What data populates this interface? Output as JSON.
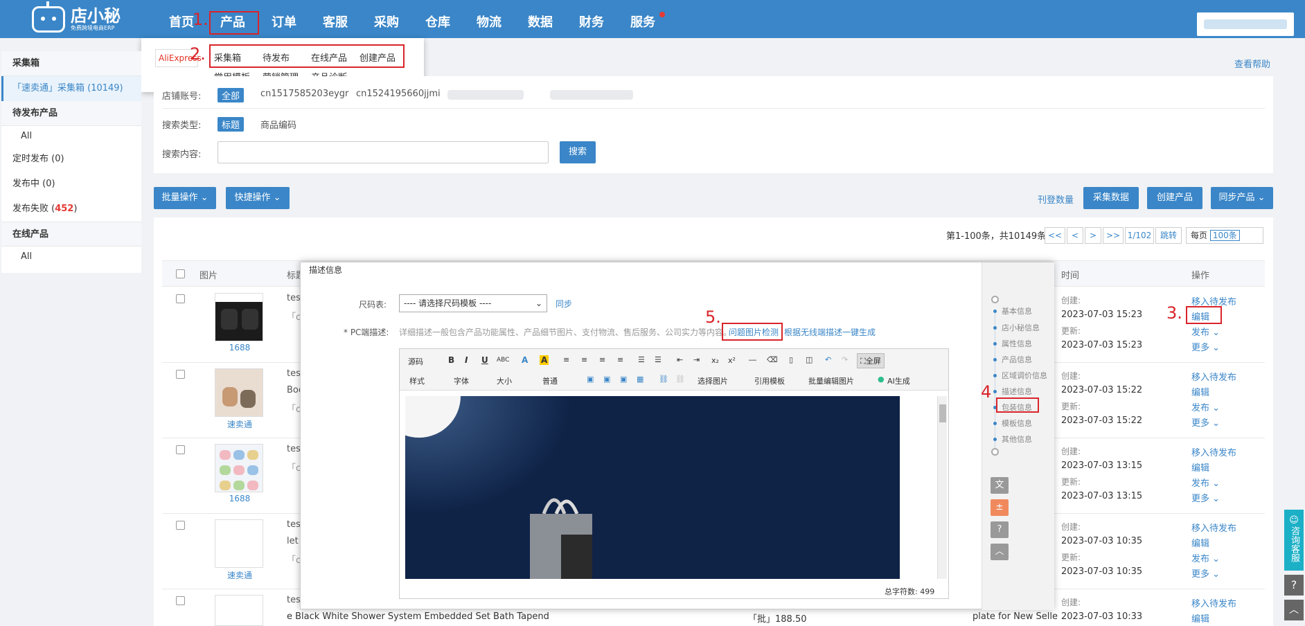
{
  "header": {
    "logo_name": "店小秘",
    "logo_slogan": "免费跨境电商ERP",
    "nav": [
      "首页",
      "产品",
      "订单",
      "客服",
      "采购",
      "仓库",
      "物流",
      "数据",
      "财务",
      "服务"
    ]
  },
  "annotations": [
    "1.",
    "2.",
    "3.",
    "4",
    "5."
  ],
  "dropdown": {
    "platform": "AliExpress",
    "row1": [
      "采集箱",
      "待发布",
      "在线产品",
      "创建产品"
    ],
    "row2": [
      "常用模板",
      "营销管理",
      "产品诊断"
    ]
  },
  "sidebar": {
    "collect_title": "采集箱",
    "collect_active": "「速卖通」采集箱 (10149)",
    "pending_title": "待发布产品",
    "pending_all": "All",
    "scheduled": "定时发布 (0)",
    "publishing": "发布中 (0)",
    "failed_label": "发布失败 (",
    "failed_count": "452",
    "failed_close": ")",
    "online_title": "在线产品",
    "online_all": "All"
  },
  "help_link": "查看帮助",
  "filter": {
    "shop_label": "店铺账号:",
    "shop_tag": "全部",
    "shop_1": "cn1517585203eygr",
    "shop_2": "cn1524195660jjmi",
    "type_label": "搜索类型:",
    "type_tag": "标题",
    "type_option": "商品编码",
    "content_label": "搜索内容:",
    "search_button": "搜索"
  },
  "toolbar": {
    "batch": "批量操作",
    "quick": "快捷操作",
    "count_link": "刊登数量",
    "collect": "采集数据",
    "create": "创建产品",
    "sync": "同步产品"
  },
  "pager": {
    "summary": "第1-100条，共10149条",
    "first": "<<",
    "prev": "<",
    "next": ">",
    "last": ">>",
    "page": "1/102",
    "jump": "跳转",
    "per_label": "每页",
    "per_value": "100条"
  },
  "table": {
    "headers": {
      "image": "图片",
      "title": "标题",
      "time": "时间",
      "ops": "操作"
    },
    "rows": [
      {
        "source": "1688",
        "title": "test",
        "created": "2023-07-03 15:23",
        "updated": "2023-07-03 15:23"
      },
      {
        "source": "速卖通",
        "title": "test",
        "title2": "Boc",
        "created": "2023-07-03 15:22",
        "updated": "2023-07-03 15:22"
      },
      {
        "source": "1688",
        "title": "test",
        "created": "2023-07-03 13:15",
        "updated": "2023-07-03 13:15"
      },
      {
        "source": "速卖通",
        "title": "test",
        "title2": "let l",
        "created": "2023-07-03 10:35",
        "updated": "2023-07-03 10:35"
      },
      {
        "source": "",
        "title": "test",
        "title2": "e Black  White Shower System Embedded Set Bath Tapend",
        "price": "「批」188.50",
        "extra": "plate for New Selle",
        "created": "2023-07-03 10:33",
        "updated": ""
      }
    ],
    "labels": {
      "created": "创建:",
      "updated": "更新:"
    },
    "ops": {
      "move": "移入待发布",
      "edit": "编辑",
      "publish": "发布",
      "more": "更多"
    },
    "chinese_fragment": "「c"
  },
  "modal": {
    "title": "描述信息",
    "size_label": "尺码表:",
    "size_placeholder": "---- 请选择尺码模板 ----",
    "sync": "同步",
    "pc_label": "* PC端描述:",
    "pc_hint": "详细描述一般包含产品功能属性、产品细节图片、支付物流、售后服务、公司实力等内容。",
    "check_images": "问题图片检测",
    "generate": "根据无线端描述一键生成",
    "toolbar_row1": [
      "源码",
      "B",
      "I",
      "U",
      "ABC",
      "A",
      "A",
      "全屏"
    ],
    "toolbar_row2": [
      "样式",
      "字体",
      "大小",
      "普通",
      "选择图片",
      "引用模板",
      "批量编辑图片",
      "AI生成"
    ],
    "char_count": "总字符数:  499",
    "side_nav": [
      "基本信息",
      "店小秘信息",
      "属性信息",
      "产品信息",
      "区域调价信息",
      "描述信息",
      "包装信息",
      "模板信息",
      "其他信息"
    ]
  },
  "float": {
    "service": "咨询客服",
    "help": "?",
    "top": "︿"
  }
}
